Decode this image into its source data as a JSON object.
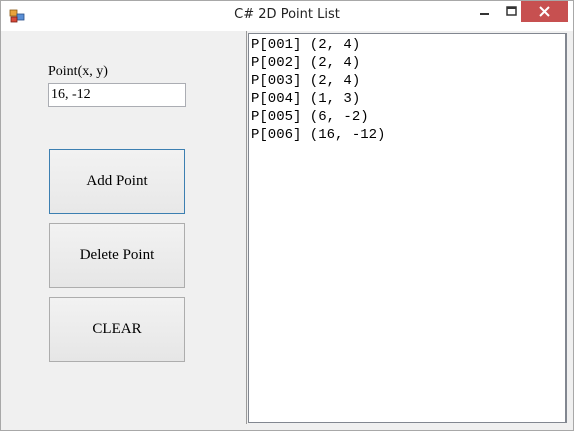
{
  "window": {
    "title": "C# 2D Point List",
    "controls": {
      "minimize_icon": "minimize-icon",
      "maximize_icon": "maximize-icon",
      "close_icon": "close-icon",
      "close_color": "#c75050"
    }
  },
  "form": {
    "point_label": "Point(x, y)",
    "point_value": "16, -12",
    "add_label": "Add Point",
    "delete_label": "Delete Point",
    "clear_label": "CLEAR"
  },
  "list": {
    "items": [
      "P[001] (2, 4)",
      "P[002] (2, 4)",
      "P[003] (2, 4)",
      "P[004] (1, 3)",
      "P[005] (6, -2)",
      "P[006] (16, -12)"
    ]
  }
}
